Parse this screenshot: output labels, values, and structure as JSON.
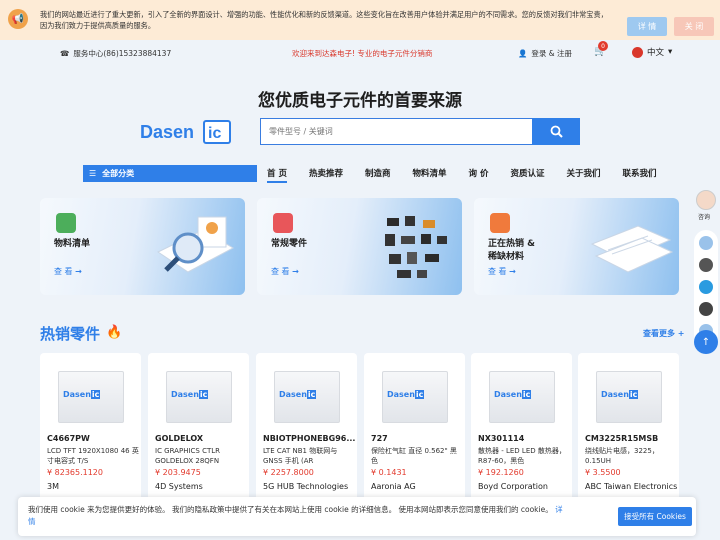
{
  "notice": {
    "message": "我们的网站最近进行了重大更新，引入了全新的界面设计、增强的功能、性能优化和新的反馈渠道。这些变化旨在改善用户体验并满足用户的不同需求。您的反馈对我们非常宝贵，因为我们致力于提供高质量的服务。",
    "details_label": "详 情",
    "close_label": "关 闭"
  },
  "topbar": {
    "service": "服务中心(86)15323884137",
    "welcome": "欢迎来到达森电子! 专业的电子元件分销商",
    "login": "登录 & 注册",
    "cart_count": "0",
    "language": "中文"
  },
  "hero": {
    "headline": "您优质电子元件的首要来源",
    "logo_text": "Dasen",
    "logo_suffix": "ic",
    "search_placeholder": "零件型号 / 关键词"
  },
  "nav": {
    "all_categories": "全部分类",
    "items": [
      "首 页",
      "热卖推荐",
      "制造商",
      "物料清单",
      "询 价",
      "资质认证",
      "关于我们",
      "联系我们"
    ]
  },
  "banners": [
    {
      "title": "物料清单",
      "link": "查 看"
    },
    {
      "title": "常规零件",
      "link": "查 看"
    },
    {
      "title": "正在热销 &",
      "title2": "稀缺材料",
      "link": "查 看"
    }
  ],
  "hot": {
    "title": "热销零件",
    "more": "查看更多 +"
  },
  "products": [
    {
      "pn": "C4667PW",
      "desc": "LCD TFT 1920X1080 46 英寸电容式 T/S",
      "price": "¥ 82365.1120",
      "mfr": "3M"
    },
    {
      "pn": "GOLDELOX",
      "desc": "IC GRAPHICS CTLR GOLDELOX 28QFN",
      "price": "¥ 203.9475",
      "mfr": "4D Systems"
    },
    {
      "pn": "NBIOTPHONEBG96...",
      "desc": "LTE CAT NB1 物联网与 GNSS 手机 (AR",
      "price": "¥ 2257.8000",
      "mfr": "5G HUB Technologies"
    },
    {
      "pn": "727",
      "desc": "保险杠气缸 直径 0.562\" 黑色",
      "price": "¥ 0.1431",
      "mfr": "Aaronia AG"
    },
    {
      "pn": "NX301114",
      "desc": "散热器 - LED LED 散热器，R87-60，黑色",
      "price": "¥ 192.1260",
      "mfr": "Boyd Corporation"
    },
    {
      "pn": "CM3225R15MSB",
      "desc": "绕线贴片电感，3225，0.15UH",
      "price": "¥ 3.5500",
      "mfr": "ABC Taiwan Electronics"
    }
  ],
  "side": {
    "consult": "咨询"
  },
  "cookie": {
    "text": "我们使用 cookie 来为您提供更好的体验。 我们的隐私政策中提供了有关在本网站上使用 cookie 的详细信息。 使用本网站即表示您同意使用我们的 cookie。",
    "link": "详 情",
    "accept": "接受所有 Cookies"
  },
  "colors": {
    "accent": "#2f7fe8",
    "price": "#e23b2e",
    "notice_bg": "#fdebd6"
  }
}
